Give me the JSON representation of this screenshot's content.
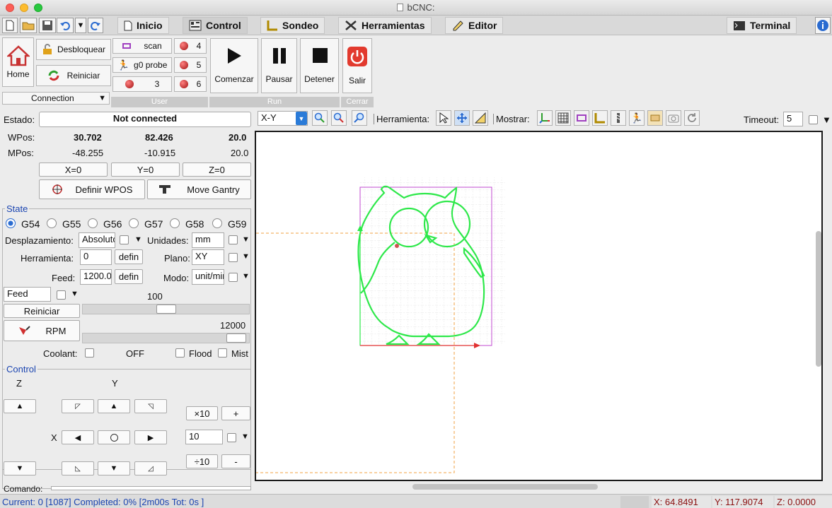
{
  "window": {
    "title": "bCNC:"
  },
  "tabs": [
    {
      "label": "Inicio"
    },
    {
      "label": "Control"
    },
    {
      "label": "Sondeo"
    },
    {
      "label": "Herramientas"
    },
    {
      "label": "Editor"
    },
    {
      "label": "Terminal"
    }
  ],
  "ribbon": {
    "home": "Home",
    "unlock": "Desbloquear",
    "reset": "Reiniciar",
    "connection": "Connection",
    "user": {
      "scan": "scan",
      "g0probe": "g0 probe",
      "n3": "3",
      "n4": "4",
      "n5": "5",
      "n6": "6",
      "label": "User"
    },
    "run": {
      "start": "Comenzar",
      "pause": "Pausar",
      "stop": "Detener",
      "label": "Run"
    },
    "close": {
      "exit": "Salir",
      "label": "Cerrar"
    }
  },
  "status": {
    "estado_label": "Estado:",
    "estado_value": "Not connected",
    "wpos_label": "WPos:",
    "wpos": [
      "30.702",
      "82.426",
      "20.0"
    ],
    "mpos_label": "MPos:",
    "mpos": [
      "-48.255",
      "-10.915",
      "20.0"
    ],
    "zero_x": "X=0",
    "zero_y": "Y=0",
    "zero_z": "Z=0",
    "define_wpos": "Definir WPOS",
    "move_gantry": "Move Gantry"
  },
  "state": {
    "legend": "State",
    "coords": [
      "G54",
      "G55",
      "G56",
      "G57",
      "G58",
      "G59"
    ],
    "desplazamiento_label": "Desplazamiento:",
    "desplazamiento_value": "Absoluto",
    "unidades_label": "Unidades:",
    "unidades_value": "mm",
    "herramienta_label": "Herramienta:",
    "herramienta_value": "0",
    "defin_label": "defin",
    "plano_label": "Plano:",
    "plano_value": "XY",
    "feed_label": "Feed:",
    "feed_value": "1200.0",
    "modo_label": "Modo:",
    "modo_value": "unit/min",
    "feed_override_value": "Feed",
    "override_value": "100",
    "override_level": 0.5,
    "reset_label": "Reiniciar",
    "rpm_label": "RPM",
    "rpm_value": "12000",
    "rpm_level": 0.98,
    "coolant_label": "Coolant:",
    "coolant_state": "OFF",
    "flood_label": "Flood",
    "mist_label": "Mist"
  },
  "control": {
    "legend": "Control",
    "z_label": "Z",
    "y_label": "Y",
    "x_label": "X",
    "x10": "×10",
    "plus": "+",
    "div10": "÷10",
    "minus": "-",
    "step_value": "10"
  },
  "command_label": "Comando:",
  "canvas_toolbar": {
    "view_value": "X-Y",
    "herramienta_label": "Herramienta:",
    "mostrar_label": "Mostrar:",
    "timeout_label": "Timeout:",
    "timeout_value": "5"
  },
  "statusbar": {
    "progress": "Current: 0 [1087]  Completed: 0% [2m00s Tot: 0s ]",
    "x": "X: 64.8491",
    "y": "Y: 117.9074",
    "z": "Z: 0.0000"
  },
  "colors": {
    "accent_blue": "#1a44b0",
    "toolpath_green": "#2ee84a",
    "margin_magenta": "#c04ad0",
    "workarea_orange": "#f0a040"
  }
}
